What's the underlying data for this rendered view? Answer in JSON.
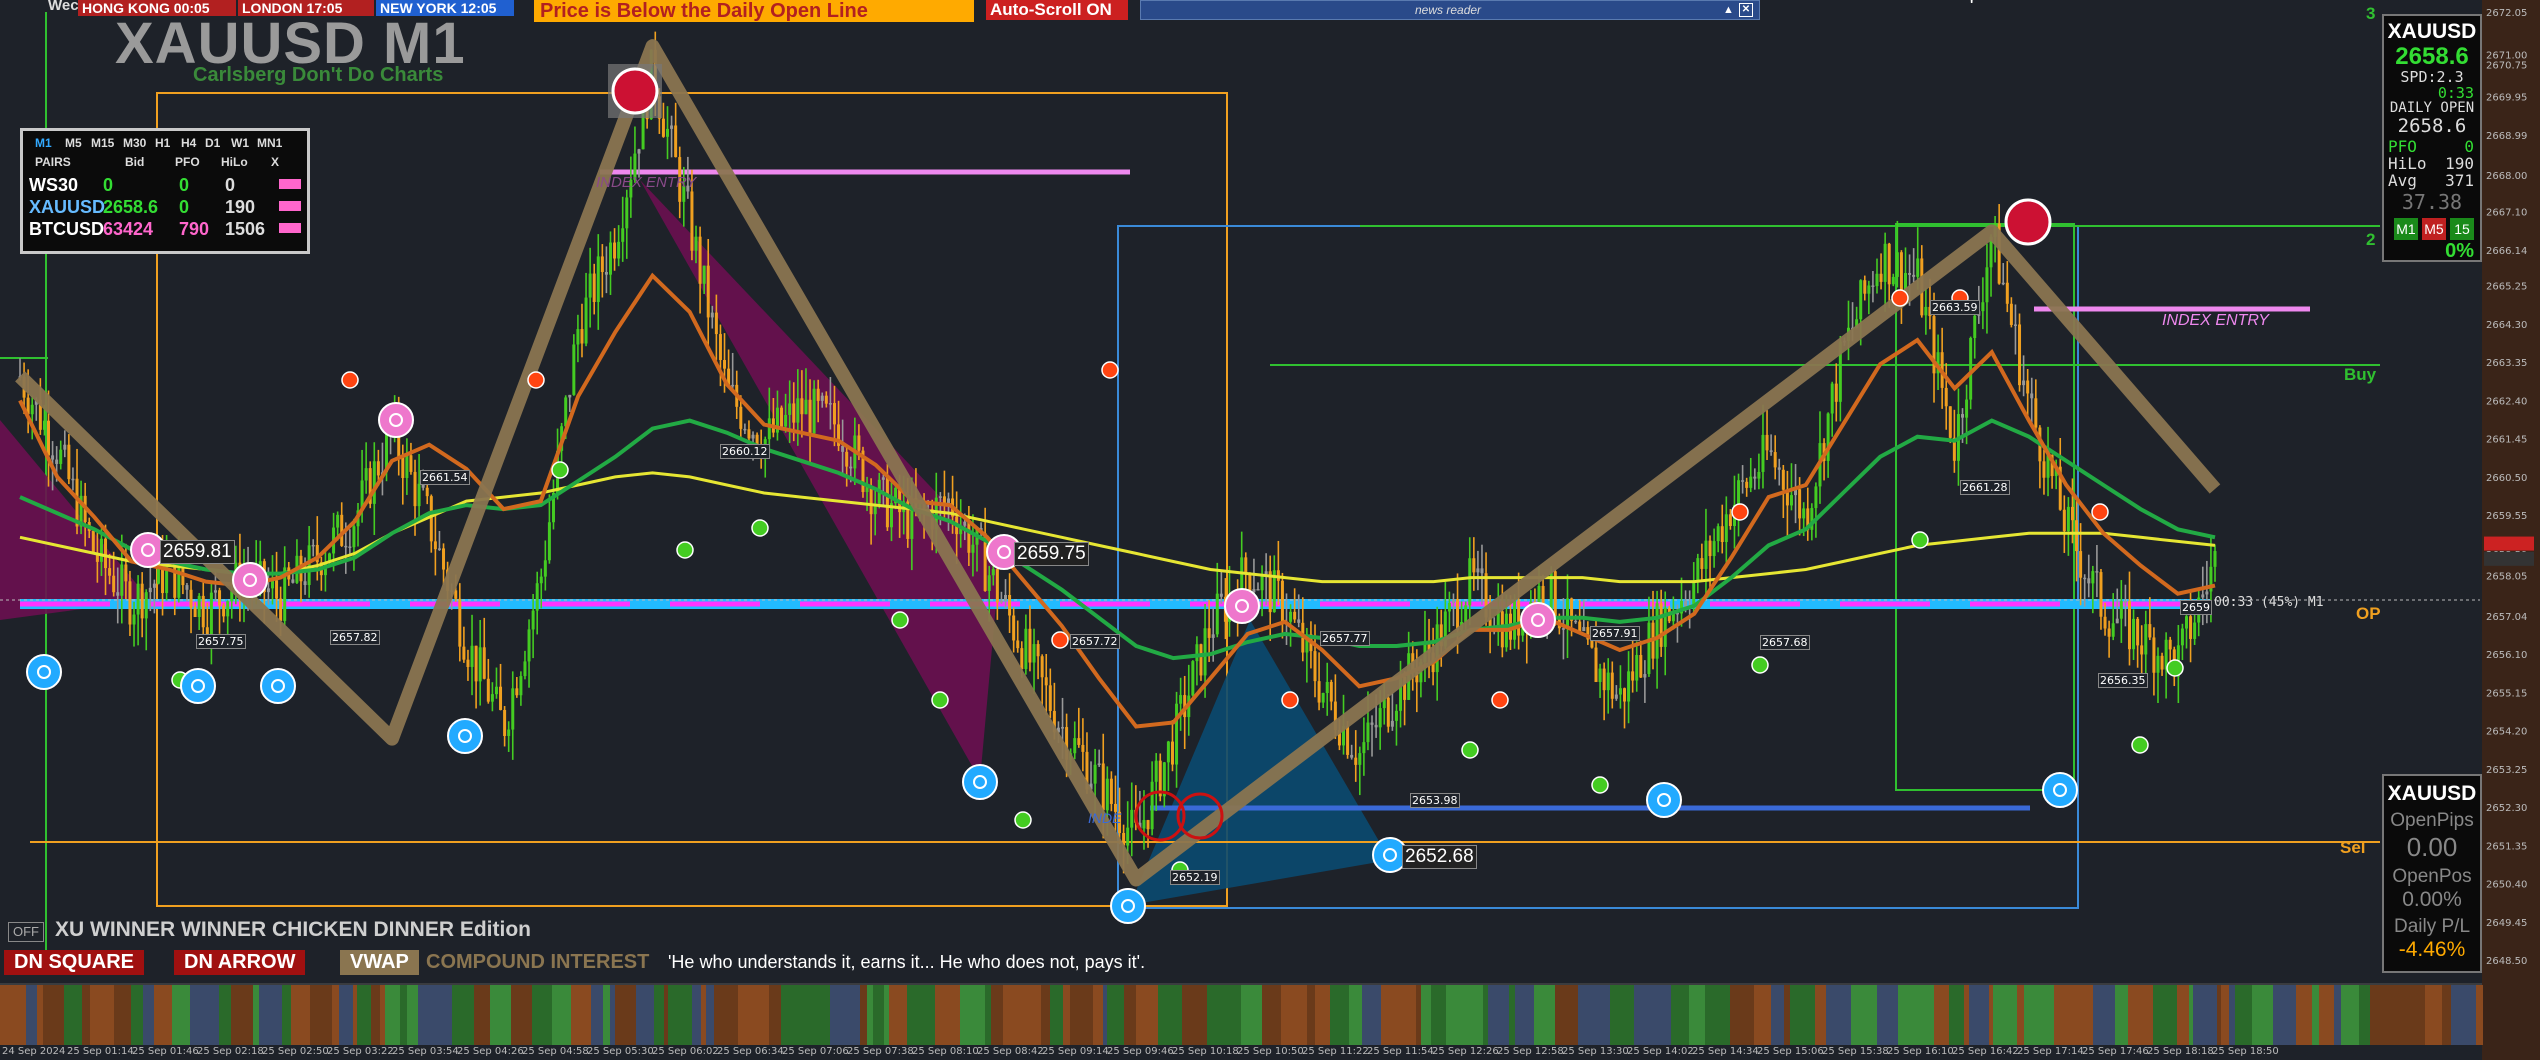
{
  "topbar": {
    "corner": "Wec",
    "hongkong": "HONG KONG 00:05",
    "london": "LONDON  17:05",
    "newyork": "NEW YORK  12:05",
    "alert": "Price is Below the Daily Open Line",
    "autoscroll": "Auto-Scroll ON",
    "news": "news reader"
  },
  "header": {
    "title": "XAUUSD M1",
    "subtitle": "Carlsberg Don't Do Charts"
  },
  "timeframe_table": {
    "tfs": [
      "M1",
      "M5",
      "M15",
      "M30",
      "H1",
      "H4",
      "D1",
      "W1",
      "MN1"
    ],
    "cols": [
      "PAIRS",
      "Bid",
      "PFO",
      "HiLo",
      "X"
    ],
    "rows": [
      {
        "pair": "WS30",
        "bid": "0",
        "pfo": "0",
        "hilo": "0",
        "bidColor": "#33dd33",
        "pfoColor": "#33dd33"
      },
      {
        "pair": "XAUUSD",
        "bid": "2658.6",
        "pfo": "0",
        "hilo": "190",
        "bidColor": "#33dd33",
        "pfoColor": "#33dd33"
      },
      {
        "pair": "BTCUSD",
        "bid": "63424",
        "pfo": "790",
        "hilo": "1506",
        "bidColor": "#ff66cc",
        "pfoColor": "#ff66cc"
      }
    ]
  },
  "info_panel": {
    "symbol": "XAUUSD",
    "bid": "2658.6",
    "spread": "SPD:2.3",
    "timer": "0:33",
    "daily_open_label": "DAILY OPEN",
    "daily_open": "2658.6",
    "pfo_label": "PFO",
    "pfo": "0",
    "hilo_label": "HiLo",
    "hilo": "190",
    "avg_label": "Avg",
    "avg": "371",
    "extra": "37.38",
    "buttons": [
      "M1",
      "M5",
      "15"
    ],
    "pct": "0%"
  },
  "account_panel": {
    "symbol": "XAUUSD",
    "open_pips_label": "OpenPips",
    "open_pips": "0.00",
    "open_pos_label": "OpenPos",
    "open_pos": "0.00%",
    "daily_pl_label": "Daily P/L",
    "daily_pl": "-4.46%"
  },
  "footer": {
    "off": "OFF",
    "edition": "XU WINNER WINNER CHICKEN DINNER Edition",
    "btn1": "DN SQUARE",
    "btn2": "DN ARROW",
    "btn3": "VWAP",
    "compound": "COMPOUND INTEREST",
    "quote": "'He who understands it, earns it... He who does not, pays it'."
  },
  "annotations": {
    "index_entry_1": "INDEX ENTRY",
    "index_entry_2": "INDEX ENTRY",
    "index_entry_3": "INDE",
    "buy": "Buy",
    "sell": "Sel",
    "op": "OP",
    "timer_line": "00:33 (45%) M1",
    "lbl_1": "2659.81",
    "lbl_2": "2659.75",
    "lbl_3": "2652.68",
    "small": [
      "2661.54",
      "2660.12",
      "2657.75",
      "2657.82",
      "2657.72",
      "2657.77",
      "2657.91",
      "2657.68",
      "2663.59",
      "2661.28",
      "2656.35",
      "2653.98",
      "2652.19",
      "2659"
    ],
    "r2": "2",
    "r3": "3"
  },
  "colors": {
    "background": "#1e2229",
    "orange_box": "#f0a020",
    "blue_box": "#3a8ad8",
    "green_box": "#30c030",
    "ema_yellow": "#e6e633",
    "ema_orange": "#d2691e",
    "ema_green": "#22aa44",
    "zigzag": "#8a7550",
    "magenta_line": "#ff33ff",
    "cyan_line": "#22bbff",
    "up_candle": "#44cc22",
    "down_candle": "#f0a020",
    "neutral_candle": "#999999"
  },
  "chart_data": {
    "type": "line",
    "symbol": "XAUUSD",
    "timeframe": "M1",
    "y_ticks": [
      2672.05,
      2671.0,
      2670.75,
      2669.95,
      2668.99,
      2668.0,
      2667.1,
      2666.14,
      2665.25,
      2664.3,
      2663.35,
      2662.4,
      2661.45,
      2660.5,
      2659.55,
      2658.82,
      2658.59,
      2658.05,
      2657.04,
      2656.1,
      2655.15,
      2654.2,
      2653.25,
      2652.3,
      2651.35,
      2650.4,
      2649.45,
      2648.5
    ],
    "x_ticks": [
      "24 Sep 2024",
      "25 Sep 01:14",
      "25 Sep 01:46",
      "25 Sep 02:18",
      "25 Sep 02:50",
      "25 Sep 03:22",
      "25 Sep 03:54",
      "25 Sep 04:26",
      "25 Sep 04:58",
      "25 Sep 05:30",
      "25 Sep 06:02",
      "25 Sep 06:34",
      "25 Sep 07:06",
      "25 Sep 07:38",
      "25 Sep 08:10",
      "25 Sep 08:42",
      "25 Sep 09:14",
      "25 Sep 09:46",
      "25 Sep 10:18",
      "25 Sep 10:50",
      "25 Sep 11:22",
      "25 Sep 11:54",
      "25 Sep 12:26",
      "25 Sep 12:58",
      "25 Sep 13:30",
      "25 Sep 14:02",
      "25 Sep 14:34",
      "25 Sep 15:06",
      "25 Sep 15:38",
      "25 Sep 16:10",
      "25 Sep 16:42",
      "25 Sep 17:14",
      "25 Sep 17:46",
      "25 Sep 18:18",
      "25 Sep 18:50"
    ],
    "ylim": [
      2648.5,
      2672.05
    ],
    "price": [
      2663.0,
      2661.2,
      2658.6,
      2657.4,
      2658.2,
      2657.2,
      2658.0,
      2657.5,
      2658.5,
      2659.5,
      2661.6,
      2659.4,
      2656.4,
      2654.3,
      2658.0,
      2664.2,
      2666.5,
      2670.6,
      2666.8,
      2662.6,
      2661.4,
      2662.2,
      2661.8,
      2660.0,
      2659.4,
      2659.9,
      2658.2,
      2656.2,
      2654.3,
      2652.9,
      2651.5,
      2654.0,
      2656.8,
      2658.2,
      2657.3,
      2655.2,
      2653.6,
      2655.2,
      2656.3,
      2657.9,
      2656.7,
      2657.8,
      2656.2,
      2655.0,
      2656.8,
      2657.9,
      2659.8,
      2661.1,
      2659.5,
      2663.6,
      2666.0,
      2665.4,
      2661.3,
      2666.6,
      2662.3,
      2659.3,
      2657.2,
      2656.5,
      2655.9,
      2658.4
    ],
    "ema_fast": [
      2662.4,
      2660.5,
      2659.5,
      2658.4,
      2658.2,
      2657.9,
      2657.8,
      2658.0,
      2658.5,
      2659.4,
      2660.9,
      2661.3,
      2660.7,
      2659.7,
      2659.9,
      2662.5,
      2664.1,
      2665.5,
      2664.6,
      2662.8,
      2661.8,
      2661.6,
      2661.4,
      2660.8,
      2659.9,
      2659.8,
      2659.0,
      2657.9,
      2656.8,
      2655.5,
      2654.3,
      2654.4,
      2655.5,
      2656.6,
      2656.9,
      2656.2,
      2655.3,
      2655.5,
      2655.9,
      2656.7,
      2656.7,
      2657.0,
      2656.6,
      2656.2,
      2656.5,
      2657.1,
      2658.5,
      2660.0,
      2660.3,
      2661.8,
      2663.3,
      2663.9,
      2662.7,
      2663.6,
      2661.9,
      2660.3,
      2659.1,
      2658.3,
      2657.6,
      2657.8
    ],
    "ema_slow": [
      2660.0,
      2659.6,
      2659.2,
      2658.7,
      2658.4,
      2658.2,
      2658.1,
      2658.1,
      2658.2,
      2658.5,
      2659.1,
      2659.6,
      2659.8,
      2659.7,
      2659.8,
      2660.4,
      2661.0,
      2661.7,
      2661.9,
      2661.6,
      2661.2,
      2660.9,
      2660.6,
      2660.2,
      2659.7,
      2659.4,
      2658.9,
      2658.3,
      2657.7,
      2657.0,
      2656.3,
      2656.0,
      2656.1,
      2656.4,
      2656.6,
      2656.5,
      2656.3,
      2656.3,
      2656.4,
      2656.7,
      2656.8,
      2657.0,
      2657.0,
      2656.9,
      2657.0,
      2657.3,
      2658.0,
      2658.8,
      2659.2,
      2660.1,
      2661.0,
      2661.5,
      2661.4,
      2661.9,
      2661.5,
      2660.9,
      2660.3,
      2659.7,
      2659.2,
      2659.0
    ],
    "vwap": [
      2659.0,
      2658.8,
      2658.6,
      2658.4,
      2658.3,
      2658.2,
      2658.1,
      2658.1,
      2658.3,
      2658.6,
      2659.1,
      2659.5,
      2659.9,
      2660.0,
      2660.1,
      2660.3,
      2660.5,
      2660.6,
      2660.5,
      2660.3,
      2660.1,
      2660.0,
      2659.9,
      2659.8,
      2659.7,
      2659.6,
      2659.4,
      2659.2,
      2659.0,
      2658.8,
      2658.6,
      2658.4,
      2658.2,
      2658.1,
      2658.0,
      2657.9,
      2657.9,
      2657.9,
      2657.9,
      2658.0,
      2658.0,
      2658.0,
      2658.0,
      2657.9,
      2657.9,
      2657.9,
      2658.0,
      2658.1,
      2658.2,
      2658.4,
      2658.6,
      2658.8,
      2658.9,
      2659.0,
      2659.1,
      2659.1,
      2659.1,
      2659.0,
      2658.9,
      2658.8
    ],
    "zigzag": [
      {
        "i": 0,
        "y": 2663.0
      },
      {
        "i": 10,
        "y": 2654.0
      },
      {
        "i": 17,
        "y": 2671.2
      },
      {
        "i": 30,
        "y": 2650.5
      },
      {
        "i": 53,
        "y": 2666.6
      },
      {
        "i": 59,
        "y": 2660.2
      }
    ],
    "daily_open": 2658.6,
    "current_price": 2658.59,
    "levels": {
      "buy": 2664.3,
      "sell": 2652.7
    }
  }
}
